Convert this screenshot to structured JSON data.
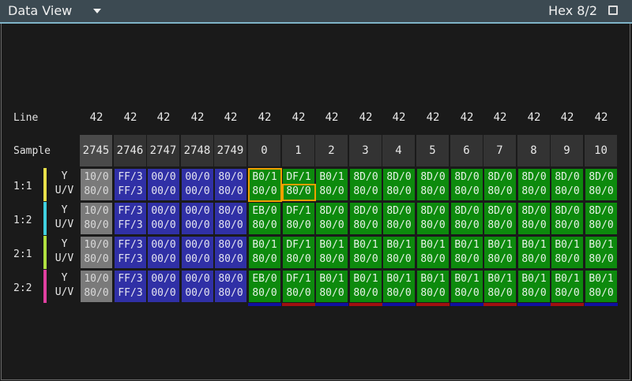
{
  "window": {
    "title": "Data View",
    "mode_label": "Hex 8/2"
  },
  "labels": {
    "line": "Line",
    "sample": "Sample",
    "y": "Y",
    "uv": "U/V"
  },
  "columns": [
    {
      "line": "42",
      "sample": "2745",
      "kind": "old"
    },
    {
      "line": "42",
      "sample": "2746",
      "kind": "pre"
    },
    {
      "line": "42",
      "sample": "2747",
      "kind": "pre"
    },
    {
      "line": "42",
      "sample": "2748",
      "kind": "pre"
    },
    {
      "line": "42",
      "sample": "2749",
      "kind": "pre"
    },
    {
      "line": "42",
      "sample": "0",
      "kind": "active",
      "underline": "blue"
    },
    {
      "line": "42",
      "sample": "1",
      "kind": "active",
      "underline": "red"
    },
    {
      "line": "42",
      "sample": "2",
      "kind": "active",
      "underline": "blue"
    },
    {
      "line": "42",
      "sample": "3",
      "kind": "active",
      "underline": "red"
    },
    {
      "line": "42",
      "sample": "4",
      "kind": "active",
      "underline": "blue"
    },
    {
      "line": "42",
      "sample": "5",
      "kind": "active",
      "underline": "red"
    },
    {
      "line": "42",
      "sample": "6",
      "kind": "active",
      "underline": "blue"
    },
    {
      "line": "42",
      "sample": "7",
      "kind": "active",
      "underline": "red"
    },
    {
      "line": "42",
      "sample": "8",
      "kind": "active",
      "underline": "blue"
    },
    {
      "line": "42",
      "sample": "9",
      "kind": "active",
      "underline": "red"
    },
    {
      "line": "42",
      "sample": "10",
      "kind": "active",
      "underline": "blue"
    }
  ],
  "rows": [
    {
      "label": "1:1",
      "color": "#e8e04a",
      "cells": [
        [
          "10/0",
          "80/0"
        ],
        [
          "FF/3",
          "FF/3"
        ],
        [
          "00/0",
          "00/0"
        ],
        [
          "00/0",
          "00/0"
        ],
        [
          "80/0",
          "80/0"
        ],
        [
          "B0/1",
          "80/0"
        ],
        [
          "DF/1",
          "80/0"
        ],
        [
          "B0/1",
          "80/0"
        ],
        [
          "8D/0",
          "80/0"
        ],
        [
          "8D/0",
          "80/0"
        ],
        [
          "8D/0",
          "80/0"
        ],
        [
          "8D/0",
          "80/0"
        ],
        [
          "8D/0",
          "80/0"
        ],
        [
          "8D/0",
          "80/0"
        ],
        [
          "8D/0",
          "80/0"
        ],
        [
          "8D/0",
          "80/0"
        ]
      ]
    },
    {
      "label": "1:2",
      "color": "#40d0e0",
      "cells": [
        [
          "10/0",
          "80/0"
        ],
        [
          "FF/3",
          "FF/3"
        ],
        [
          "00/0",
          "00/0"
        ],
        [
          "00/0",
          "00/0"
        ],
        [
          "80/0",
          "80/0"
        ],
        [
          "EB/0",
          "80/0"
        ],
        [
          "DF/1",
          "80/0"
        ],
        [
          "8D/0",
          "80/0"
        ],
        [
          "8D/0",
          "80/0"
        ],
        [
          "8D/0",
          "80/0"
        ],
        [
          "8D/0",
          "80/0"
        ],
        [
          "8D/0",
          "80/0"
        ],
        [
          "8D/0",
          "80/0"
        ],
        [
          "8D/0",
          "80/0"
        ],
        [
          "8D/0",
          "80/0"
        ],
        [
          "8D/0",
          "80/0"
        ]
      ]
    },
    {
      "label": "2:1",
      "color": "#b0e040",
      "cells": [
        [
          "10/0",
          "80/0"
        ],
        [
          "FF/3",
          "FF/3"
        ],
        [
          "00/0",
          "00/0"
        ],
        [
          "00/0",
          "00/0"
        ],
        [
          "80/0",
          "80/0"
        ],
        [
          "B0/1",
          "80/0"
        ],
        [
          "DF/1",
          "80/0"
        ],
        [
          "B0/1",
          "80/0"
        ],
        [
          "B0/1",
          "80/0"
        ],
        [
          "B0/1",
          "80/0"
        ],
        [
          "B0/1",
          "80/0"
        ],
        [
          "B0/1",
          "80/0"
        ],
        [
          "B0/1",
          "80/0"
        ],
        [
          "B0/1",
          "80/0"
        ],
        [
          "B0/1",
          "80/0"
        ],
        [
          "B0/1",
          "80/0"
        ]
      ]
    },
    {
      "label": "2:2",
      "color": "#e040a0",
      "cells": [
        [
          "10/0",
          "80/0"
        ],
        [
          "FF/3",
          "FF/3"
        ],
        [
          "00/0",
          "00/0"
        ],
        [
          "00/0",
          "00/0"
        ],
        [
          "80/0",
          "80/0"
        ],
        [
          "EB/0",
          "80/0"
        ],
        [
          "DF/1",
          "80/0"
        ],
        [
          "B0/1",
          "80/0"
        ],
        [
          "B0/1",
          "80/0"
        ],
        [
          "B0/1",
          "80/0"
        ],
        [
          "B0/1",
          "80/0"
        ],
        [
          "B0/1",
          "80/0"
        ],
        [
          "B0/1",
          "80/0"
        ],
        [
          "B0/1",
          "80/0"
        ],
        [
          "B0/1",
          "80/0"
        ],
        [
          "B0/1",
          "80/0"
        ]
      ]
    }
  ],
  "colors": {
    "old": "#7a7a7a",
    "pre": "#3030a6",
    "active": "#0d8a0d",
    "highlight": "#f0a000",
    "underline_blue": "#1010a0",
    "underline_red": "#a01010"
  },
  "icons": {
    "dropdown": "chevron-down-icon",
    "maximize": "maximize-icon"
  }
}
